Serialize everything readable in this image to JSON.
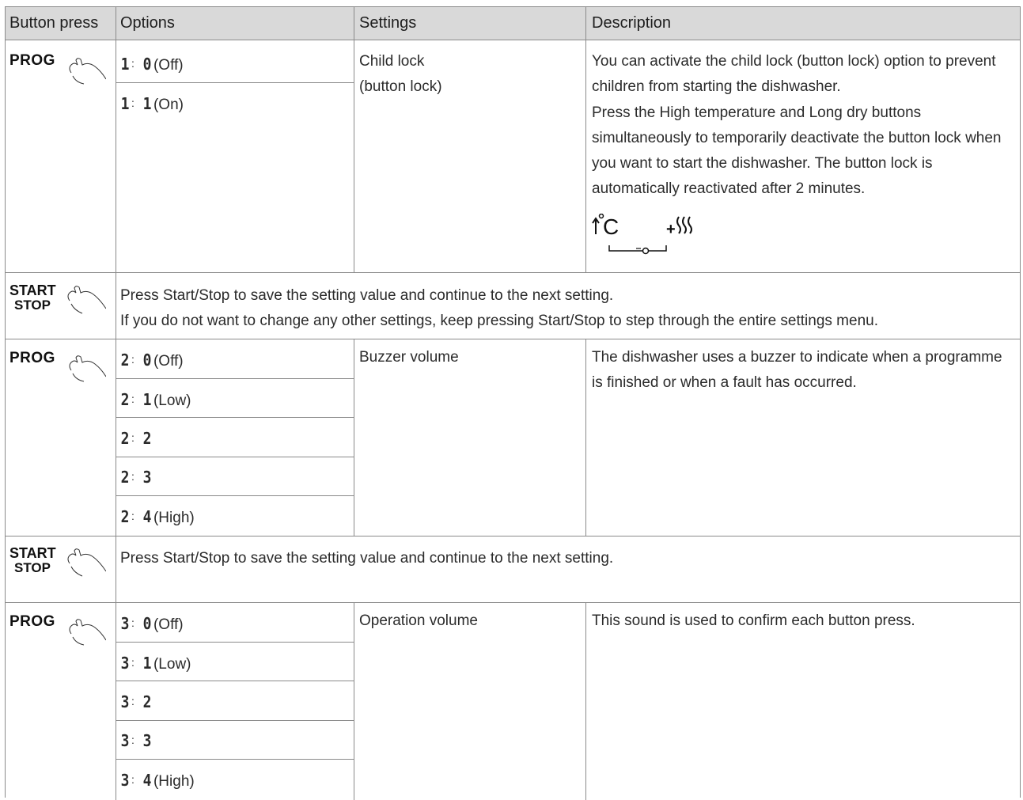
{
  "header": {
    "col1": "Button press",
    "col2": "Options",
    "col3": "Settings",
    "col4": "Description"
  },
  "buttons": {
    "prog": "PROG",
    "start": "START",
    "stop": "STOP"
  },
  "section1": {
    "options": [
      {
        "num": "1",
        "val": "0",
        "note": "(Off)"
      },
      {
        "num": "1",
        "val": "1",
        "note": "(On)"
      }
    ],
    "setting_line1": "Child lock",
    "setting_line2": "(button lock)",
    "desc_p1": "You can activate the child lock (button lock) option to prevent children from starting the dishwasher.",
    "desc_p2": "Press the High temperature and Long dry buttons simultaneously to temporarily deactivate the button lock when you want to start the dishwasher. The button lock is automatically reactivated after 2 minutes.",
    "icon_left_text": "C",
    "icon_right_text": "+"
  },
  "start1": {
    "line1": "Press Start/Stop to save the setting value and continue to the next setting.",
    "line2": "If you do not want to change any other settings, keep pressing Start/Stop to step through the entire settings menu."
  },
  "section2": {
    "options": [
      {
        "num": "2",
        "val": "0",
        "note": "(Off)"
      },
      {
        "num": "2",
        "val": "1",
        "note": "(Low)"
      },
      {
        "num": "2",
        "val": "2",
        "note": ""
      },
      {
        "num": "2",
        "val": "3",
        "note": ""
      },
      {
        "num": "2",
        "val": "4",
        "note": "(High)"
      }
    ],
    "setting": "Buzzer volume",
    "desc": "The dishwasher uses a buzzer to indicate when a programme is finished or when a fault has occurred."
  },
  "start2": {
    "line1": "Press Start/Stop to save the setting value and continue to the next setting."
  },
  "section3": {
    "options": [
      {
        "num": "3",
        "val": "0",
        "note": "(Off)"
      },
      {
        "num": "3",
        "val": "1",
        "note": "(Low)"
      },
      {
        "num": "3",
        "val": "2",
        "note": ""
      },
      {
        "num": "3",
        "val": "3",
        "note": ""
      },
      {
        "num": "3",
        "val": "4",
        "note": "(High)"
      }
    ],
    "setting": "Operation volume",
    "desc": "This sound is used to confirm each button press."
  },
  "colors": {
    "header_bg": "#d9d9d9",
    "grid": "#8a8a8a",
    "text": "#2b2b2b"
  }
}
